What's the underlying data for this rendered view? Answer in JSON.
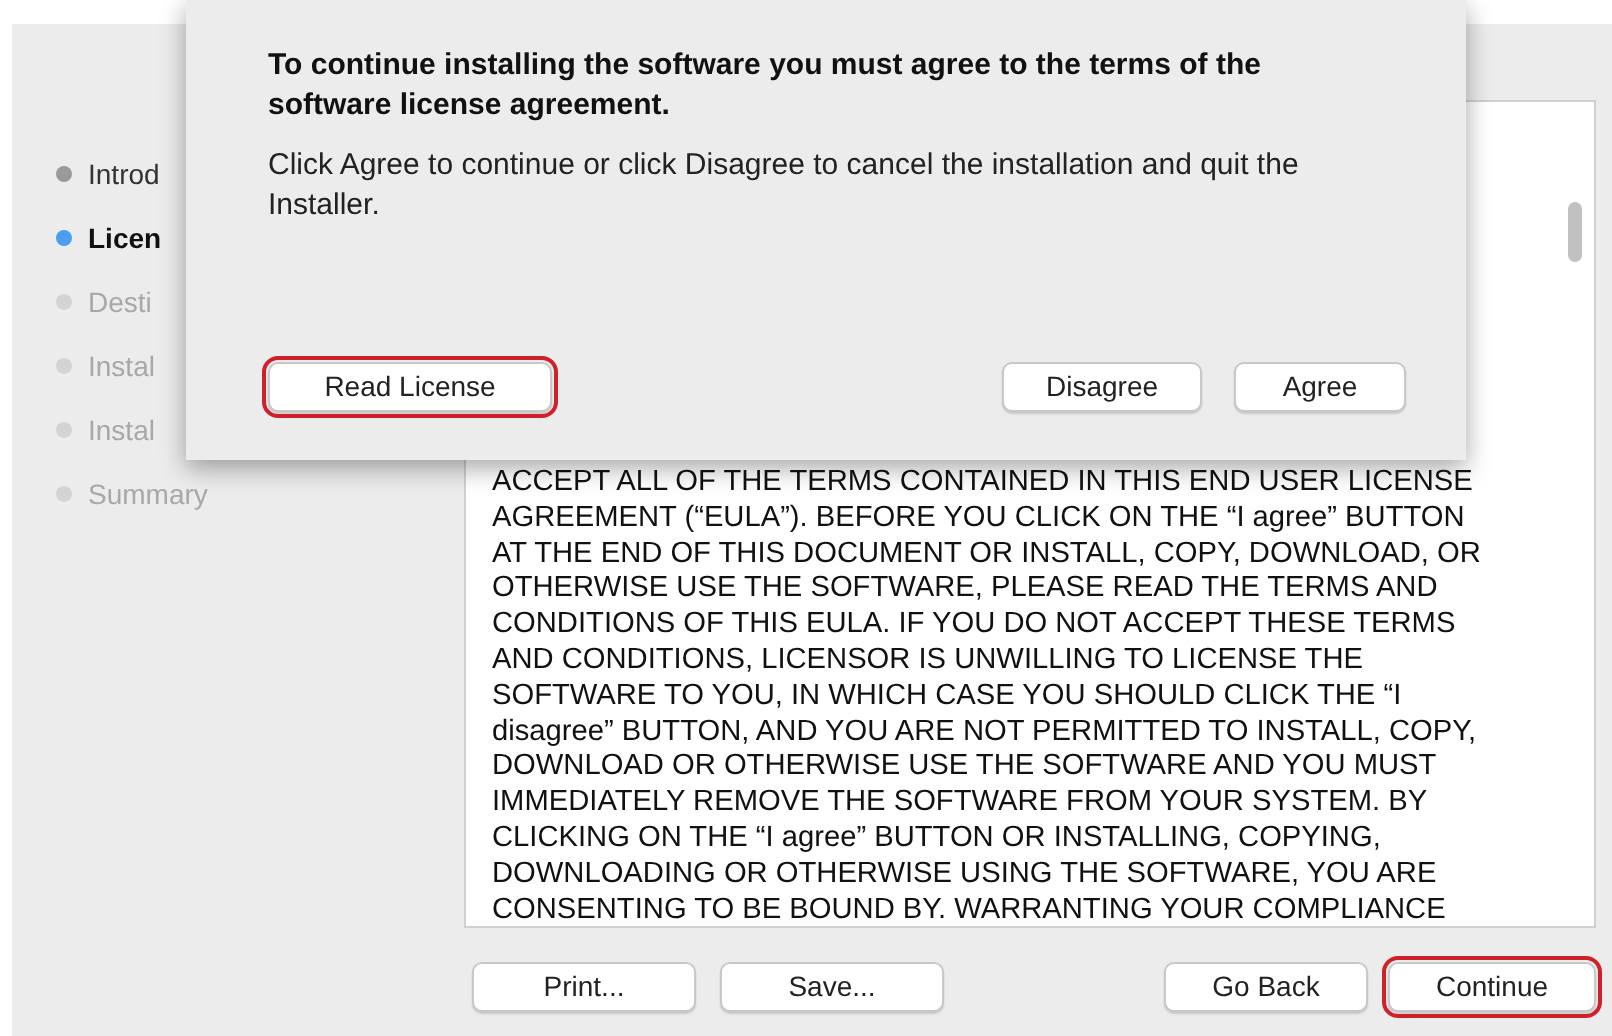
{
  "sidebar": {
    "items": [
      {
        "label": "Introd",
        "completed": true,
        "selected": false
      },
      {
        "label": "Licen",
        "completed": false,
        "selected": true
      },
      {
        "label": "Desti",
        "completed": false,
        "selected": false
      },
      {
        "label": "Instal",
        "completed": false,
        "selected": false
      },
      {
        "label": "Instal",
        "completed": false,
        "selected": false
      },
      {
        "label": "Summary",
        "completed": false,
        "selected": false
      }
    ]
  },
  "license_text": {
    "lines": [
      "ACCEPT ALL OF THE TERMS CONTAINED IN THIS END USER LICENSE",
      "AGREEMENT (“EULA”).  BEFORE YOU CLICK ON THE “I agree” BUTTON",
      "AT THE END OF THIS DOCUMENT OR INSTALL, COPY, DOWNLOAD, OR",
      "OTHERWISE USE THE SOFTWARE, PLEASE READ THE TERMS AND",
      "CONDITIONS OF THIS EULA.  IF YOU DO NOT ACCEPT THESE TERMS",
      "AND CONDITIONS, LICENSOR IS UNWILLING TO LICENSE THE",
      "SOFTWARE TO YOU, IN WHICH CASE YOU SHOULD CLICK THE “I",
      "disagree” BUTTON, AND YOU ARE NOT PERMITTED TO INSTALL, COPY,",
      "DOWNLOAD OR OTHERWISE USE THE SOFTWARE AND YOU MUST",
      "IMMEDIATELY REMOVE THE SOFTWARE FROM YOUR SYSTEM.  BY",
      "CLICKING ON THE “I agree” BUTTON OR INSTALLING, COPYING,",
      "DOWNLOADING OR OTHERWISE USING THE SOFTWARE, YOU ARE",
      "CONSENTING TO BE BOUND BY. WARRANTING YOUR COMPLIANCE"
    ]
  },
  "footer_buttons": [
    {
      "label": "Print...",
      "highlighted": false
    },
    {
      "label": "Save...",
      "highlighted": false
    },
    {
      "label": "Go Back",
      "highlighted": false
    },
    {
      "label": "Continue",
      "highlighted": true
    }
  ],
  "sheet": {
    "title": "To continue installing the software you must agree to the terms of the software license agreement.",
    "message": "Click Agree to continue or click Disagree to cancel the installation and quit the Installer.",
    "buttons": [
      {
        "label": "Read License",
        "highlighted": true
      },
      {
        "label": "Disagree",
        "highlighted": false
      },
      {
        "label": "Agree",
        "highlighted": false
      }
    ]
  }
}
